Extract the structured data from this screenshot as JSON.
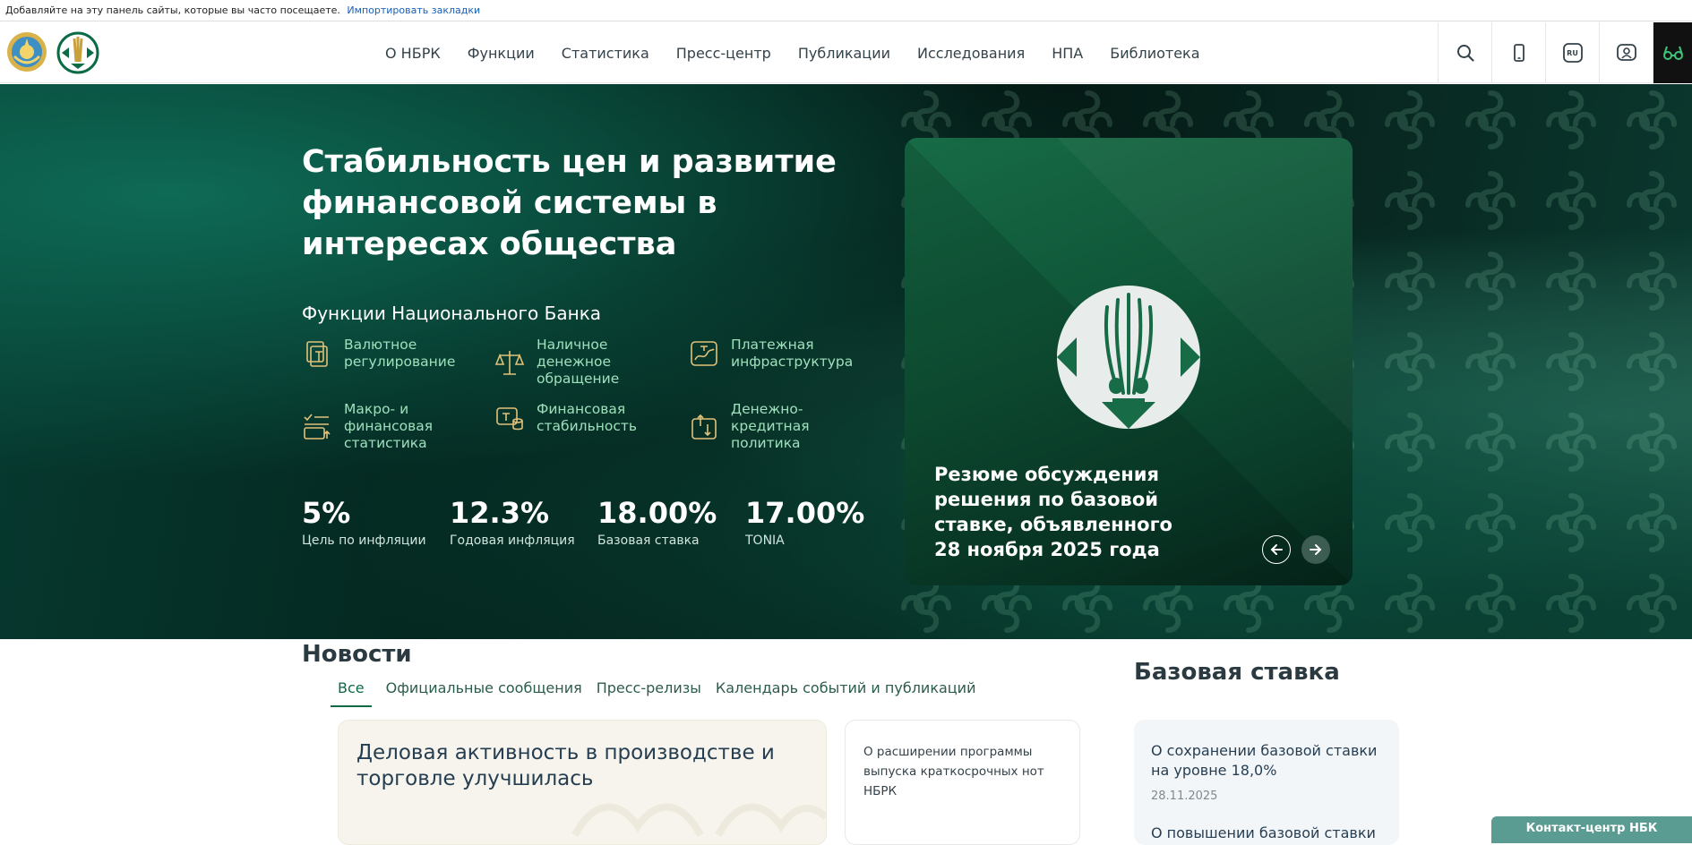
{
  "bookmarks_bar": {
    "text": "Добавляйте на эту панель сайты, которые вы часто посещаете.",
    "import_link": "Импортировать закладки"
  },
  "header": {
    "nav": [
      {
        "label": "О НБРК"
      },
      {
        "label": "Функции"
      },
      {
        "label": "Статистика"
      },
      {
        "label": "Пресс-центр"
      },
      {
        "label": "Публикации"
      },
      {
        "label": "Исследования"
      },
      {
        "label": "НПА"
      },
      {
        "label": "Библиотека"
      }
    ],
    "tools": {
      "search_icon": "search-icon",
      "mobile_icon": "mobile-icon",
      "language": "RU",
      "account_icon": "account-icon",
      "accessibility_icon": "glasses-icon"
    }
  },
  "hero": {
    "title": "Стабильность цен и развитие финансовой системы в интересах общества",
    "functions_heading": "Функции Национального Банка",
    "functions": [
      {
        "label": "Валютное регулирование",
        "icon": "currency-icon"
      },
      {
        "label": "Наличное денежное обращение",
        "icon": "scales-icon"
      },
      {
        "label": "Платежная инфраструктура",
        "icon": "payment-icon"
      },
      {
        "label": "Макро- и финансовая статистика",
        "icon": "statistics-icon"
      },
      {
        "label": "Финансовая стабильность",
        "icon": "stability-icon"
      },
      {
        "label": "Денежно-кредитная политика",
        "icon": "monetary-policy-icon"
      }
    ],
    "stats": [
      {
        "value": "5%",
        "caption": "Цель по инфляции"
      },
      {
        "value": "12.3%",
        "caption": "Годовая инфляция"
      },
      {
        "value": "18.00%",
        "caption": "Базовая ставка"
      },
      {
        "value": "17.00%",
        "caption": "TONIA"
      }
    ],
    "card": {
      "title": "Резюме обсуждения решения по базовой ставке, объявленного 28 ноября 2025 года"
    }
  },
  "news": {
    "title": "Новости",
    "tabs": [
      {
        "label": "Все"
      },
      {
        "label": "Официальные сообщения"
      },
      {
        "label": "Пресс-релизы"
      },
      {
        "label": "Календарь событий и публикаций"
      }
    ],
    "main_item": "Деловая активность в производстве и торговле улучшилась",
    "side_item": "О расширении программы выпуска краткосрочных нот НБРК"
  },
  "base_rate": {
    "title": "Базовая ставка",
    "items": [
      {
        "title": "О сохранении базовой ставки на уровне 18,0%",
        "date": "28.11.2025"
      },
      {
        "title": "О повышении базовой ставки"
      }
    ]
  },
  "contact_center": "Контакт-центр НБК",
  "colors": {
    "accent_green": "#0b6b45",
    "function_label": "#9fe0bc",
    "icon_gold": "#e2c27a"
  }
}
